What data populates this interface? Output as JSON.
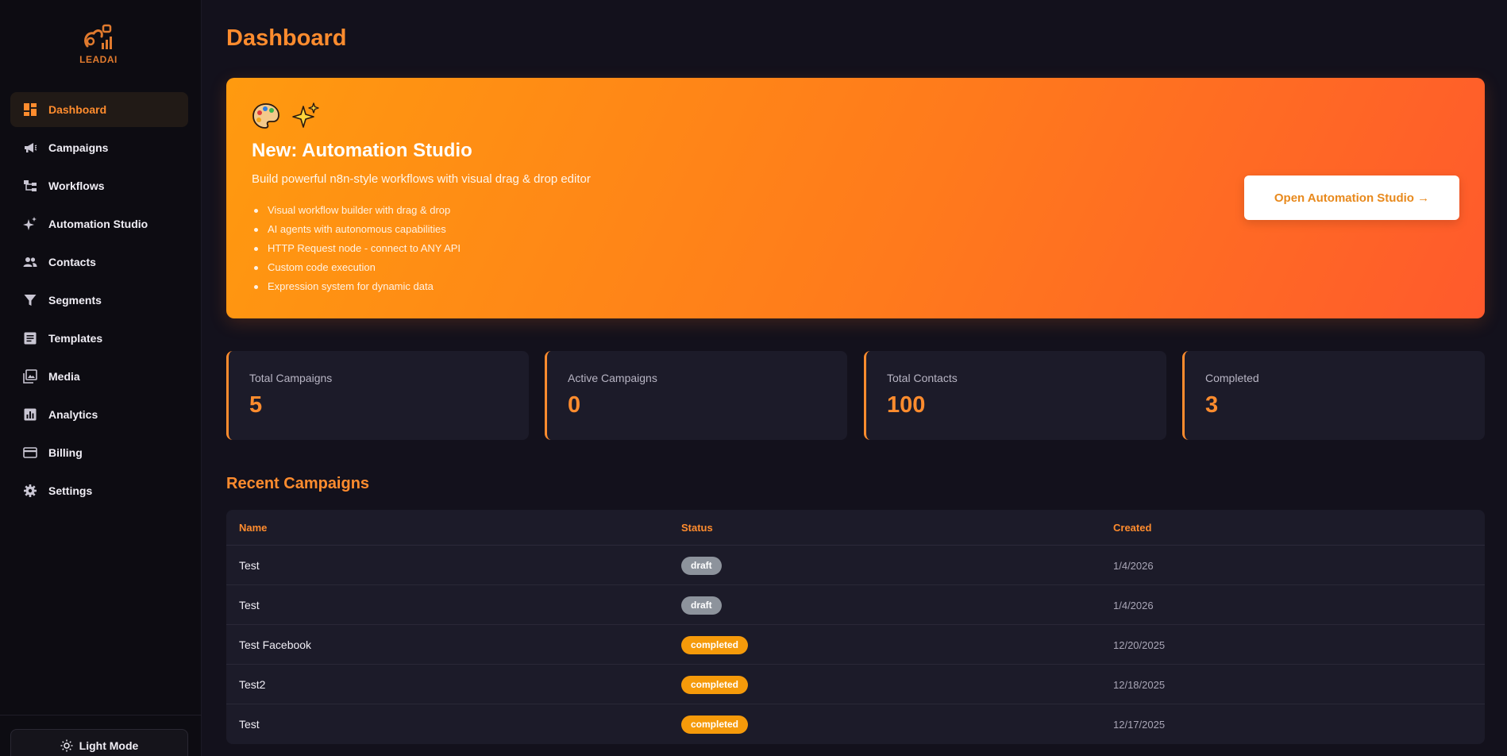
{
  "brand": {
    "logo_text": "LEADAI"
  },
  "sidebar": {
    "items": [
      {
        "label": "Dashboard",
        "icon": "dashboard-icon",
        "active": true
      },
      {
        "label": "Campaigns",
        "icon": "megaphone-icon"
      },
      {
        "label": "Workflows",
        "icon": "workflow-icon"
      },
      {
        "label": "Automation Studio",
        "icon": "sparkles-icon"
      },
      {
        "label": "Contacts",
        "icon": "people-icon"
      },
      {
        "label": "Segments",
        "icon": "filter-icon"
      },
      {
        "label": "Templates",
        "icon": "document-icon"
      },
      {
        "label": "Media",
        "icon": "image-icon"
      },
      {
        "label": "Analytics",
        "icon": "chart-icon"
      },
      {
        "label": "Billing",
        "icon": "credit-card-icon"
      },
      {
        "label": "Settings",
        "icon": "gear-icon"
      }
    ],
    "theme_toggle": "Light Mode"
  },
  "page": {
    "title": "Dashboard"
  },
  "hero": {
    "title": "New: Automation Studio",
    "subtitle": "Build powerful n8n-style workflows with visual drag & drop editor",
    "features": [
      "Visual workflow builder with drag & drop",
      "AI agents with autonomous capabilities",
      "HTTP Request node - connect to ANY API",
      "Custom code execution",
      "Expression system for dynamic data"
    ],
    "cta": "Open Automation Studio →"
  },
  "stats": [
    {
      "label": "Total Campaigns",
      "value": "5"
    },
    {
      "label": "Active Campaigns",
      "value": "0"
    },
    {
      "label": "Total Contacts",
      "value": "100"
    },
    {
      "label": "Completed",
      "value": "3"
    }
  ],
  "recent": {
    "title": "Recent Campaigns",
    "columns": [
      "Name",
      "Status",
      "Created"
    ],
    "rows": [
      {
        "name": "Test",
        "status": "draft",
        "created": "1/4/2026"
      },
      {
        "name": "Test",
        "status": "draft",
        "created": "1/4/2026"
      },
      {
        "name": "Test Facebook",
        "status": "completed",
        "created": "12/20/2025"
      },
      {
        "name": "Test2",
        "status": "completed",
        "created": "12/18/2025"
      },
      {
        "name": "Test",
        "status": "completed",
        "created": "12/17/2025"
      }
    ]
  },
  "colors": {
    "accent": "#ff8c2e",
    "background": "#13111c",
    "sidebar": "#0d0c12",
    "card": "#1c1b29",
    "draft": "#8d939c",
    "completed": "#f59a0a"
  }
}
